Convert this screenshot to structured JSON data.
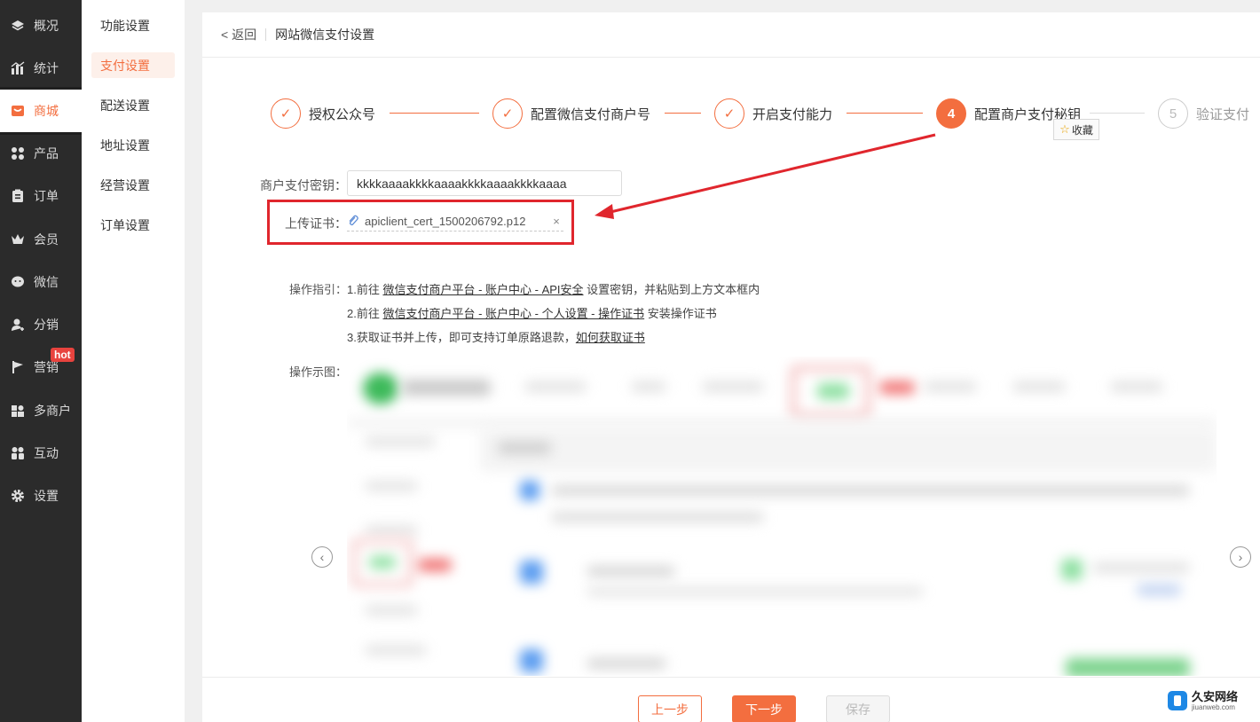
{
  "nav": {
    "items": [
      {
        "label": "概况",
        "icon": "layers-icon"
      },
      {
        "label": "统计",
        "icon": "chart-icon"
      },
      {
        "label": "商城",
        "icon": "shop-icon",
        "active": true
      },
      {
        "label": "产品",
        "icon": "grid-icon"
      },
      {
        "label": "订单",
        "icon": "order-icon"
      },
      {
        "label": "会员",
        "icon": "crown-icon"
      },
      {
        "label": "微信",
        "icon": "wechat-icon"
      },
      {
        "label": "分销",
        "icon": "user-share-icon"
      },
      {
        "label": "营销",
        "icon": "flag-icon",
        "badge": "hot"
      },
      {
        "label": "多商户",
        "icon": "multi-store-icon"
      },
      {
        "label": "互动",
        "icon": "interact-icon"
      },
      {
        "label": "设置",
        "icon": "gear-icon"
      }
    ]
  },
  "subnav": {
    "items": [
      {
        "label": "功能设置"
      },
      {
        "label": "支付设置",
        "active": true
      },
      {
        "label": "配送设置"
      },
      {
        "label": "地址设置"
      },
      {
        "label": "经营设置"
      },
      {
        "label": "订单设置"
      }
    ]
  },
  "header": {
    "back_label": "< 返回",
    "title": "网站微信支付设置"
  },
  "steps": [
    {
      "label": "授权公众号",
      "state": "done",
      "mark": "✓"
    },
    {
      "label": "配置微信支付商户号",
      "state": "done",
      "mark": "✓"
    },
    {
      "label": "开启支付能力",
      "state": "done",
      "mark": "✓"
    },
    {
      "label": "配置商户支付秘钥",
      "state": "current",
      "mark": "4"
    },
    {
      "label": "验证支付",
      "state": "pending",
      "mark": "5"
    }
  ],
  "favorite_tag": "收藏",
  "form": {
    "key_label": "商户支付密钥：",
    "key_value": "kkkkaaaakkkkaaaakkkkaaaakkkkaaaa",
    "cert_label": "上传证书：",
    "cert_file": "apiclient_cert_1500206792.p12",
    "cert_remove": "×"
  },
  "guide": {
    "label": "操作指引：",
    "line1_prefix": "1.前往 ",
    "line1_link": "微信支付商户平台 - 账户中心 - API安全",
    "line1_suffix": " 设置密钥，并粘贴到上方文本框内",
    "line2_prefix": "2.前往 ",
    "line2_link": "微信支付商户平台 - 账户中心 - 个人设置 - 操作证书",
    "line2_suffix": " 安装操作证书",
    "line3_prefix": "3.获取证书并上传，即可支持订单原路退款，",
    "line3_link": "如何获取证书"
  },
  "demo": {
    "label": "操作示图：",
    "prev": "‹",
    "next": "›"
  },
  "footer": {
    "prev_label": "上一步",
    "next_label": "下一步",
    "save_label": "保存"
  },
  "watermark": {
    "cn": "久安网络",
    "en": "jiuanweb.com"
  },
  "colors": {
    "accent": "#f36e3f",
    "nav_bg": "#2b2b2b",
    "highlight_red": "#e0262d"
  }
}
